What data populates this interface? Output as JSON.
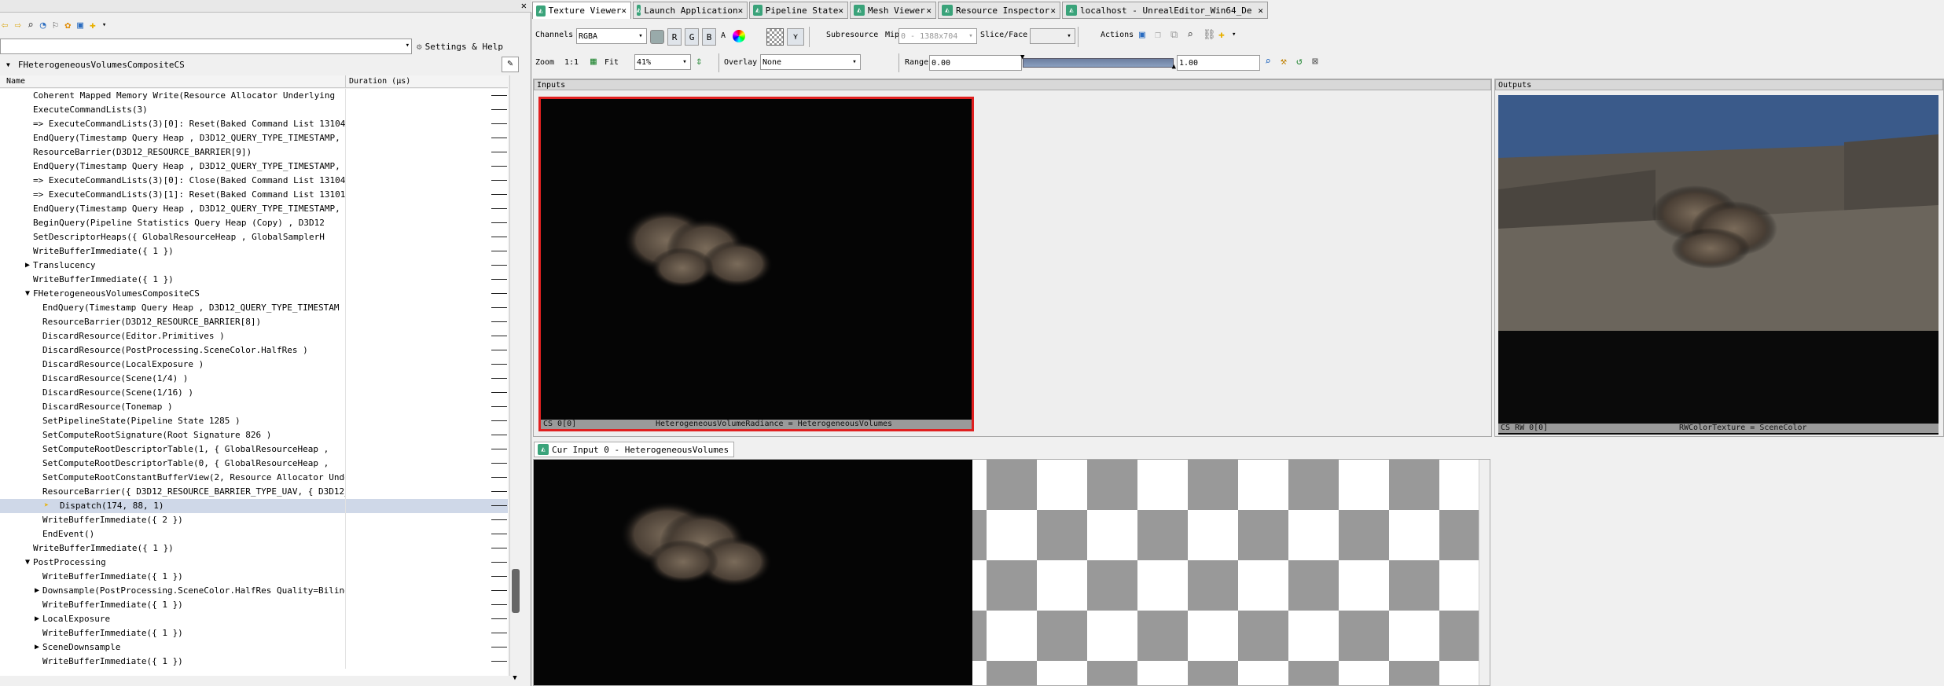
{
  "left_panel": {
    "settings_label": "Settings & Help",
    "section_title": "FHeterogeneousVolumesCompositeCS",
    "columns": [
      "Name",
      "Duration (µs)"
    ],
    "events": [
      {
        "indent": 0,
        "text": "Coherent  Mapped  Memory  Write(Resource Allocator Underlying",
        "expand": ""
      },
      {
        "indent": 0,
        "text": "ExecuteCommandLists(3)",
        "expand": ""
      },
      {
        "indent": 0,
        "text": "=>  ExecuteCommandLists(3)[0]:  Reset(Baked Command List 13104",
        "expand": ""
      },
      {
        "indent": 0,
        "text": "EndQuery(Timestamp Query Heap ,  D3D12_QUERY_TYPE_TIMESTAMP,",
        "expand": ""
      },
      {
        "indent": 0,
        "text": "ResourceBarrier(D3D12_RESOURCE_BARRIER[9])",
        "expand": ""
      },
      {
        "indent": 0,
        "text": "EndQuery(Timestamp Query Heap ,  D3D12_QUERY_TYPE_TIMESTAMP,",
        "expand": ""
      },
      {
        "indent": 0,
        "text": "=>  ExecuteCommandLists(3)[0]:  Close(Baked Command List 13104",
        "expand": ""
      },
      {
        "indent": 0,
        "text": "=>  ExecuteCommandLists(3)[1]:  Reset(Baked Command List 13101",
        "expand": ""
      },
      {
        "indent": 0,
        "text": "EndQuery(Timestamp Query Heap ,  D3D12_QUERY_TYPE_TIMESTAMP,",
        "expand": ""
      },
      {
        "indent": 0,
        "text": "BeginQuery(Pipeline Statistics Query Heap (Copy) ,  D3D12",
        "expand": ""
      },
      {
        "indent": 0,
        "text": "SetDescriptorHeaps({  GlobalResourceHeap ,  GlobalSamplerH",
        "expand": ""
      },
      {
        "indent": 0,
        "text": "WriteBufferImmediate({ 1 })",
        "expand": ""
      },
      {
        "indent": 0,
        "text": "Translucency",
        "expand": "collapsed"
      },
      {
        "indent": 0,
        "text": "WriteBufferImmediate({ 1 })",
        "expand": ""
      },
      {
        "indent": 0,
        "text": "FHeterogeneousVolumesCompositeCS",
        "expand": "expanded"
      },
      {
        "indent": 1,
        "text": "EndQuery(Timestamp Query Heap ,  D3D12_QUERY_TYPE_TIMESTAM",
        "expand": ""
      },
      {
        "indent": 1,
        "text": "ResourceBarrier(D3D12_RESOURCE_BARRIER[8])",
        "expand": ""
      },
      {
        "indent": 1,
        "text": "DiscardResource(Editor.Primitives )",
        "expand": ""
      },
      {
        "indent": 1,
        "text": "DiscardResource(PostProcessing.SceneColor.HalfRes )",
        "expand": ""
      },
      {
        "indent": 1,
        "text": "DiscardResource(LocalExposure )",
        "expand": ""
      },
      {
        "indent": 1,
        "text": "DiscardResource(Scene(1/4) )",
        "expand": ""
      },
      {
        "indent": 1,
        "text": "DiscardResource(Scene(1/16) )",
        "expand": ""
      },
      {
        "indent": 1,
        "text": "DiscardResource(Tonemap )",
        "expand": ""
      },
      {
        "indent": 1,
        "text": "SetPipelineState(Pipeline State 1285 )",
        "expand": ""
      },
      {
        "indent": 1,
        "text": "SetComputeRootSignature(Root Signature 826 )",
        "expand": ""
      },
      {
        "indent": 1,
        "text": "SetComputeRootDescriptorTable(1,  {  GlobalResourceHeap ,",
        "expand": ""
      },
      {
        "indent": 1,
        "text": "SetComputeRootDescriptorTable(0,  {  GlobalResourceHeap ,",
        "expand": ""
      },
      {
        "indent": 1,
        "text": "SetComputeRootConstantBufferView(2,  Resource Allocator Unde",
        "expand": ""
      },
      {
        "indent": 1,
        "text": "ResourceBarrier({  D3D12_RESOURCE_BARRIER_TYPE_UAV,  {  D3D12_RE",
        "expand": ""
      },
      {
        "indent": 1,
        "text": "Dispatch(174, 88, 1)",
        "expand": "current"
      },
      {
        "indent": 1,
        "text": "WriteBufferImmediate({ 2 })",
        "expand": ""
      },
      {
        "indent": 1,
        "text": "EndEvent()",
        "expand": ""
      },
      {
        "indent": 0,
        "text": "WriteBufferImmediate({ 1 })",
        "expand": ""
      },
      {
        "indent": 0,
        "text": "PostProcessing",
        "expand": "expanded"
      },
      {
        "indent": 1,
        "text": "WriteBufferImmediate({ 1 })",
        "expand": ""
      },
      {
        "indent": 1,
        "text": "Downsample(PostProcessing.SceneColor.HalfRes Quality=Bilinear",
        "expand": "collapsed"
      },
      {
        "indent": 1,
        "text": "WriteBufferImmediate({ 1 })",
        "expand": ""
      },
      {
        "indent": 1,
        "text": "LocalExposure",
        "expand": "collapsed"
      },
      {
        "indent": 1,
        "text": "WriteBufferImmediate({ 1 })",
        "expand": ""
      },
      {
        "indent": 1,
        "text": "SceneDownsample",
        "expand": "collapsed"
      },
      {
        "indent": 1,
        "text": "WriteBufferImmediate({ 1 })",
        "expand": ""
      }
    ]
  },
  "tabs": [
    {
      "label": "Texture Viewer",
      "active": true
    },
    {
      "label": "Launch Application",
      "active": false
    },
    {
      "label": "Pipeline State",
      "active": false
    },
    {
      "label": "Mesh Viewer",
      "active": false
    },
    {
      "label": "Resource Inspector",
      "active": false
    },
    {
      "label": "localhost - UnrealEditor_Win64_De",
      "active": false
    }
  ],
  "toolbar1": {
    "channels_label": "Channels",
    "channels_value": "RGBA",
    "r": "R",
    "g": "G",
    "b": "B",
    "a": "A",
    "subresource_label": "Subresource",
    "mip_label": "Mip",
    "mip_value": "0 - 1388x704",
    "slice_label": "Slice/Face",
    "actions_label": "Actions"
  },
  "toolbar2": {
    "zoom_label": "Zoom",
    "zoom_1to1": "1:1",
    "fit_label": "Fit",
    "zoom_value": "41%",
    "overlay_label": "Overlay",
    "overlay_value": "None",
    "range_label": "Range",
    "range_min": "0.00",
    "range_max": "1.00"
  },
  "inputs": {
    "header": "Inputs",
    "thumb_status_left": "CS 0[0]",
    "thumb_status_center": "HeterogeneousVolumeRadiance = HeterogeneousVolumes"
  },
  "outputs": {
    "header": "Outputs",
    "thumb_status_left": "CS RW 0[0]",
    "thumb_status_center": "RWColorTexture = SceneColor"
  },
  "main_view": {
    "tab_label": "Cur Input 0 - HeterogeneousVolumes"
  },
  "colors": {
    "selection_border": "#e02020",
    "tab_icon": "#3aa37a",
    "smoke": "#6b5f50"
  }
}
